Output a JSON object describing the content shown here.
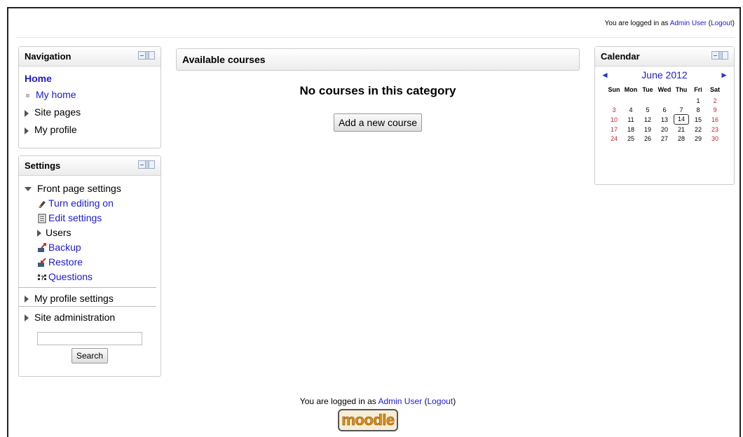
{
  "header": {
    "logged_in_prefix": "You are logged in as ",
    "user_name": "Admin User",
    "logout_open": " (",
    "logout_label": "Logout",
    "logout_close": ")"
  },
  "navigation": {
    "title": "Navigation",
    "home": "Home",
    "my_home": "My home",
    "site_pages": "Site pages",
    "my_profile": "My profile"
  },
  "settings": {
    "title": "Settings",
    "front_page_settings": "Front page settings",
    "turn_editing_on": "Turn editing on",
    "edit_settings": "Edit settings",
    "users": "Users",
    "backup": "Backup",
    "restore": "Restore",
    "questions": "Questions",
    "my_profile_settings": "My profile settings",
    "site_administration": "Site administration",
    "search_value": "",
    "search_button": "Search"
  },
  "main": {
    "title": "Available courses",
    "empty_message": "No courses in this category",
    "add_course_button": "Add a new course"
  },
  "calendar": {
    "title": "Calendar",
    "month_label": "June 2012",
    "prev_arrow": "◄",
    "next_arrow": "►",
    "weekdays": [
      "Sun",
      "Mon",
      "Tue",
      "Wed",
      "Thu",
      "Fri",
      "Sat"
    ],
    "weeks": [
      [
        "",
        "",
        "",
        "",
        "",
        "1",
        "2"
      ],
      [
        "3",
        "4",
        "5",
        "6",
        "7",
        "8",
        "9"
      ],
      [
        "10",
        "11",
        "12",
        "13",
        "14",
        "15",
        "16"
      ],
      [
        "17",
        "18",
        "19",
        "20",
        "21",
        "22",
        "23"
      ],
      [
        "24",
        "25",
        "26",
        "27",
        "28",
        "29",
        "30"
      ]
    ],
    "today": "14",
    "weekend_color": "#c8232a"
  },
  "footer": {
    "logged_in_prefix": "You are logged in as ",
    "user_name": "Admin User",
    "logout_open": " (",
    "logout_label": "Logout",
    "logout_close": ")",
    "logo_text": "moodle"
  },
  "colors": {
    "link": "#1a1adb",
    "border": "#cccccc"
  }
}
